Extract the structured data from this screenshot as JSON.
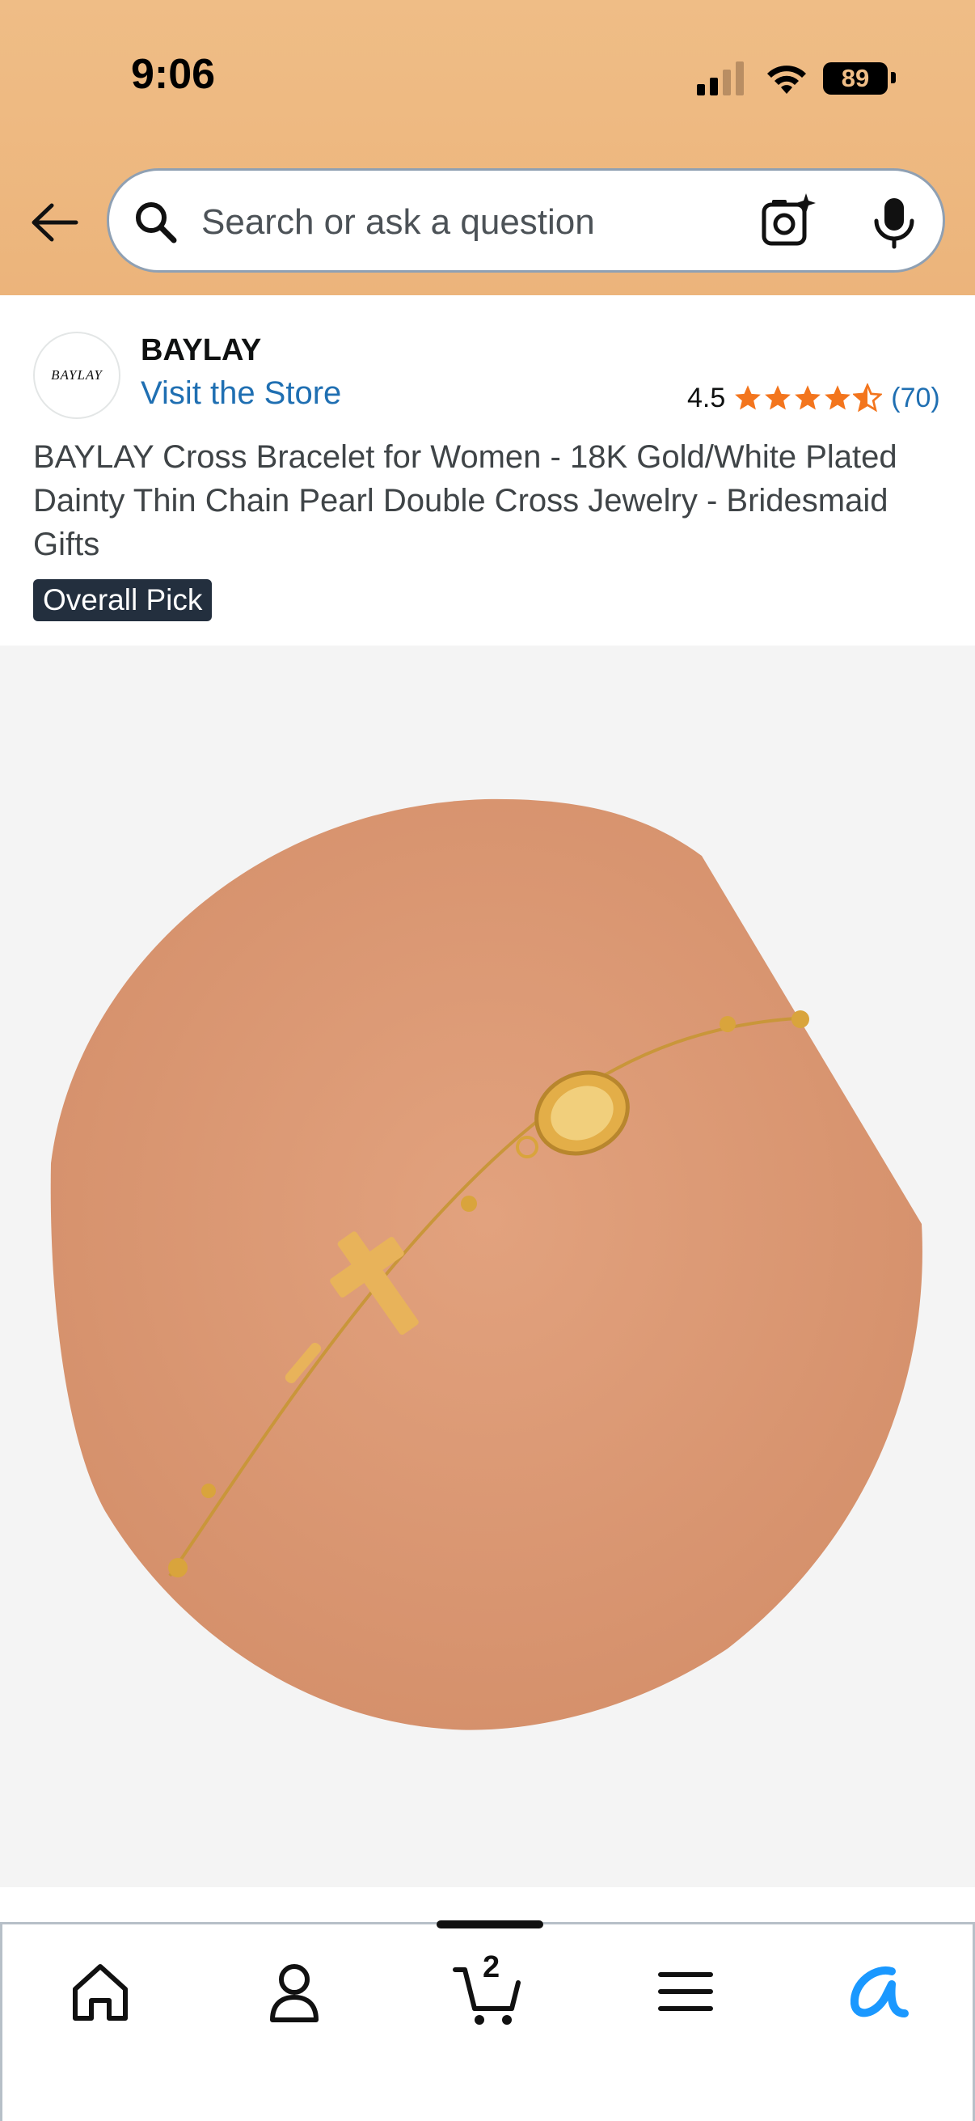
{
  "status_bar": {
    "time": "9:06",
    "battery": "89"
  },
  "search": {
    "placeholder": "Search or ask a question"
  },
  "store": {
    "logo_text": "BAYLAY",
    "brand": "BAYLAY",
    "visit_label": "Visit the Store",
    "rating": "4.5",
    "stars": 4.5,
    "rating_count": "(70)"
  },
  "product": {
    "title": "BAYLAY Cross Bracelet for Women - 18K Gold/White Plated Dainty Thin Chain Pearl Double Cross Jewelry - Bridesmaid Gifts",
    "badge": "Overall Pick"
  },
  "nav": {
    "items": [
      "home-icon",
      "account-icon",
      "cart-icon",
      "menu-icon",
      "rufus-icon"
    ],
    "cart_count": "2",
    "active_color": "#000000",
    "rufus_color": "#1a98ff"
  },
  "colors": {
    "header": "#efbd86",
    "link": "#1f6fb2",
    "star": "#f3751d",
    "badge": "#232f3e"
  }
}
